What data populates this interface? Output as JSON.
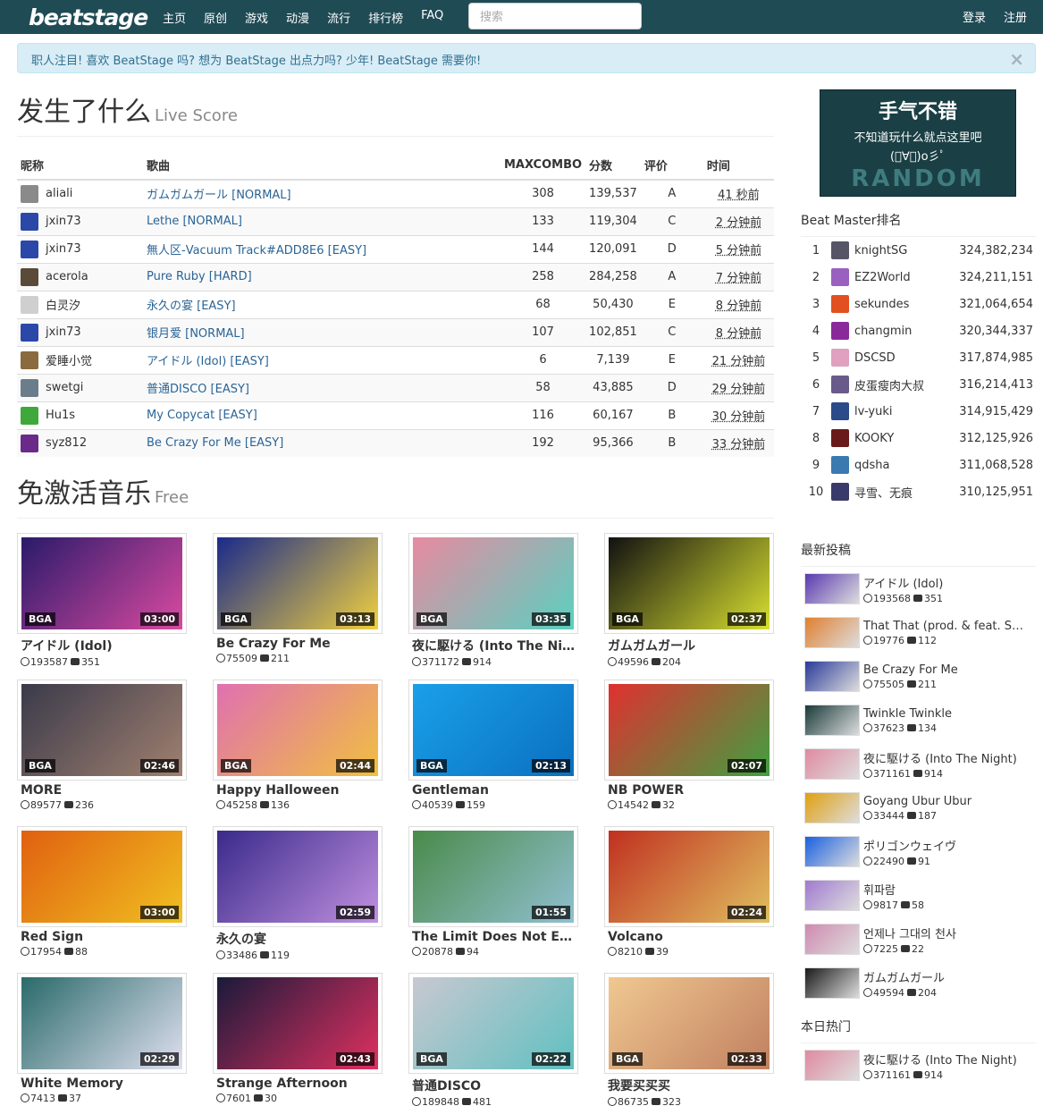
{
  "nav": {
    "logo": "beatstage",
    "links": [
      "主页",
      "原创",
      "游戏",
      "动漫",
      "流行",
      "排行榜",
      "FAQ"
    ],
    "search_placeholder": "搜索",
    "login": "登录",
    "register": "注册"
  },
  "alert": {
    "text": "职人注目! 喜欢 BeatStage 吗? 想为 BeatStage 出点力吗? 少年! BeatStage 需要你!",
    "close": "×"
  },
  "live": {
    "title": "发生了什么",
    "subtitle": "Live Score",
    "headers": [
      "昵称",
      "歌曲",
      "MAXCOMBO",
      "分数",
      "评价",
      "时间"
    ],
    "rows": [
      {
        "player": "aliali",
        "song": "ガムガムガール [NORMAL]",
        "combo": "308",
        "score": "139,537",
        "grade": "A",
        "time": "41 秒前",
        "color": "#8a8a8a"
      },
      {
        "player": "jxin73",
        "song": "Lethe [NORMAL]",
        "combo": "133",
        "score": "119,304",
        "grade": "C",
        "time": "2 分钟前",
        "color": "#2b48a8"
      },
      {
        "player": "jxin73",
        "song": "無人区-Vacuum Track#ADD8E6 [EASY]",
        "combo": "144",
        "score": "120,091",
        "grade": "D",
        "time": "5 分钟前",
        "color": "#2b48a8"
      },
      {
        "player": "acerola",
        "song": "Pure Ruby [HARD]",
        "combo": "258",
        "score": "284,258",
        "grade": "A",
        "time": "7 分钟前",
        "color": "#5a4a3a"
      },
      {
        "player": "白灵汐",
        "song": "永久の宴 [EASY]",
        "combo": "68",
        "score": "50,430",
        "grade": "E",
        "time": "8 分钟前",
        "color": "#cfcfcf"
      },
      {
        "player": "jxin73",
        "song": "银月爱 [NORMAL]",
        "combo": "107",
        "score": "102,851",
        "grade": "C",
        "time": "8 分钟前",
        "color": "#2b48a8"
      },
      {
        "player": "爱睡小觉",
        "song": "アイドル (Idol) [EASY]",
        "combo": "6",
        "score": "7,139",
        "grade": "E",
        "time": "21 分钟前",
        "color": "#8b6a3e"
      },
      {
        "player": "swetgi",
        "song": "普通DISCO [EASY]",
        "combo": "58",
        "score": "43,885",
        "grade": "D",
        "time": "29 分钟前",
        "color": "#6b7d8a"
      },
      {
        "player": "Hu1s",
        "song": "My Copycat [EASY]",
        "combo": "116",
        "score": "60,167",
        "grade": "B",
        "time": "30 分钟前",
        "color": "#3fa83a"
      },
      {
        "player": "syz812",
        "song": "Be Crazy For Me [EASY]",
        "combo": "192",
        "score": "95,366",
        "grade": "B",
        "time": "33 分钟前",
        "color": "#6a2a8a"
      }
    ]
  },
  "free": {
    "title": "免激活音乐",
    "subtitle": "Free",
    "cards": [
      {
        "title": "アイドル (Idol)",
        "plays": "193587",
        "comments": "351",
        "dur": "03:00",
        "bga": "BGA",
        "c1": "#2a1a6a",
        "c2": "#d94aa0"
      },
      {
        "title": "Be Crazy For Me",
        "plays": "75509",
        "comments": "211",
        "dur": "03:13",
        "bga": "BGA",
        "c1": "#1a2a8a",
        "c2": "#f0d040"
      },
      {
        "title": "夜に駆ける (Into The Ni…",
        "plays": "371172",
        "comments": "914",
        "dur": "03:35",
        "bga": "BGA",
        "c1": "#e88aa0",
        "c2": "#5ad0c0"
      },
      {
        "title": "ガムガムガール",
        "plays": "49596",
        "comments": "204",
        "dur": "02:37",
        "bga": "BGA",
        "c1": "#111111",
        "c2": "#d8e030"
      },
      {
        "title": "MORE",
        "plays": "89577",
        "comments": "236",
        "dur": "02:46",
        "bga": "BGA",
        "c1": "#3a3a4a",
        "c2": "#a08070"
      },
      {
        "title": "Happy Halloween",
        "plays": "45258",
        "comments": "136",
        "dur": "02:44",
        "bga": "BGA",
        "c1": "#e070b0",
        "c2": "#f0c040"
      },
      {
        "title": "Gentleman",
        "plays": "40539",
        "comments": "159",
        "dur": "02:13",
        "bga": "BGA",
        "c1": "#1aa0e8",
        "c2": "#0a70c0"
      },
      {
        "title": "NB POWER",
        "plays": "14542",
        "comments": "32",
        "dur": "02:07",
        "bga": "",
        "c1": "#e03030",
        "c2": "#40a040"
      },
      {
        "title": "Red Sign",
        "plays": "17954",
        "comments": "88",
        "dur": "03:00",
        "bga": "",
        "c1": "#e06010",
        "c2": "#f0c020"
      },
      {
        "title": "永久の宴",
        "plays": "33486",
        "comments": "119",
        "dur": "02:59",
        "bga": "",
        "c1": "#3a2a8a",
        "c2": "#c090e0"
      },
      {
        "title": "The Limit Does Not Exist",
        "plays": "20878",
        "comments": "94",
        "dur": "01:55",
        "bga": "",
        "c1": "#4a8a4a",
        "c2": "#90c0d0"
      },
      {
        "title": "Volcano",
        "plays": "8210",
        "comments": "39",
        "dur": "02:24",
        "bga": "",
        "c1": "#c03020",
        "c2": "#e0c060"
      },
      {
        "title": "White Memory",
        "plays": "7413",
        "comments": "37",
        "dur": "02:29",
        "bga": "",
        "c1": "#2a6a6a",
        "c2": "#e0e0f0"
      },
      {
        "title": "Strange Afternoon",
        "plays": "7601",
        "comments": "30",
        "dur": "02:43",
        "bga": "",
        "c1": "#1a1a3a",
        "c2": "#e03060"
      },
      {
        "title": "普通DISCO",
        "plays": "189848",
        "comments": "481",
        "dur": "02:22",
        "bga": "BGA",
        "c1": "#c8c8d0",
        "c2": "#60c0c0"
      },
      {
        "title": "我要买买买",
        "plays": "86735",
        "comments": "323",
        "dur": "02:33",
        "bga": "BGA",
        "c1": "#f0c890",
        "c2": "#c08060"
      }
    ]
  },
  "sidebar": {
    "random": {
      "line1": "手气不错",
      "line2": "不知道玩什么就点这里吧",
      "line3": "(ﾟ∀ﾟ)o彡ﾟ",
      "line4": "RANDOM"
    },
    "rank_title": "Beat Master排名",
    "ranks": [
      {
        "no": "1",
        "name": "knightSG",
        "score": "324,382,234",
        "color": "#555566"
      },
      {
        "no": "2",
        "name": "EZ2World",
        "score": "324,211,151",
        "color": "#9a60c0"
      },
      {
        "no": "3",
        "name": "sekundes",
        "score": "321,064,654",
        "color": "#e05020"
      },
      {
        "no": "4",
        "name": "changmin",
        "score": "320,344,337",
        "color": "#8a2a9a"
      },
      {
        "no": "5",
        "name": "DSCSD",
        "score": "317,874,985",
        "color": "#e0a0c0"
      },
      {
        "no": "6",
        "name": "皮蛋瘦肉大叔",
        "score": "316,214,413",
        "color": "#6a5a8a"
      },
      {
        "no": "7",
        "name": "lv-yuki",
        "score": "314,915,429",
        "color": "#2a4a8a"
      },
      {
        "no": "8",
        "name": "KOOKY",
        "score": "312,125,926",
        "color": "#6a1a1a"
      },
      {
        "no": "9",
        "name": "qdsha",
        "score": "311,068,528",
        "color": "#3a7ab0"
      },
      {
        "no": "10",
        "name": "寻雪、无痕",
        "score": "310,125,951",
        "color": "#3a3a6a"
      }
    ],
    "latest_title": "最新投稿",
    "latest": [
      {
        "title": "アイドル (Idol)",
        "plays": "193568",
        "comments": "351",
        "c": "#5a3ab0"
      },
      {
        "title": "That That (prod. & feat. SUG…",
        "plays": "19776",
        "comments": "112",
        "c": "#e08030"
      },
      {
        "title": "Be Crazy For Me",
        "plays": "75505",
        "comments": "211",
        "c": "#2a3a9a"
      },
      {
        "title": "Twinkle Twinkle",
        "plays": "37623",
        "comments": "134",
        "c": "#1a3a3a"
      },
      {
        "title": "夜に駆ける (Into The Night)",
        "plays": "371161",
        "comments": "914",
        "c": "#e08aa0"
      },
      {
        "title": "Goyang Ubur Ubur",
        "plays": "33444",
        "comments": "187",
        "c": "#e0a010"
      },
      {
        "title": "ポリゴンウェイヴ",
        "plays": "22490",
        "comments": "91",
        "c": "#1a60e0"
      },
      {
        "title": "휘파람",
        "plays": "9817",
        "comments": "58",
        "c": "#a07ad0"
      },
      {
        "title": "언제나 그대의 천사",
        "plays": "7225",
        "comments": "22",
        "c": "#d08ab0"
      },
      {
        "title": "ガムガムガール",
        "plays": "49594",
        "comments": "204",
        "c": "#1a1a1a"
      }
    ],
    "hot_title": "本日热门",
    "hot": [
      {
        "title": "夜に駆ける (Into The Night)",
        "plays": "371161",
        "comments": "914",
        "c": "#e08aa0"
      }
    ]
  }
}
